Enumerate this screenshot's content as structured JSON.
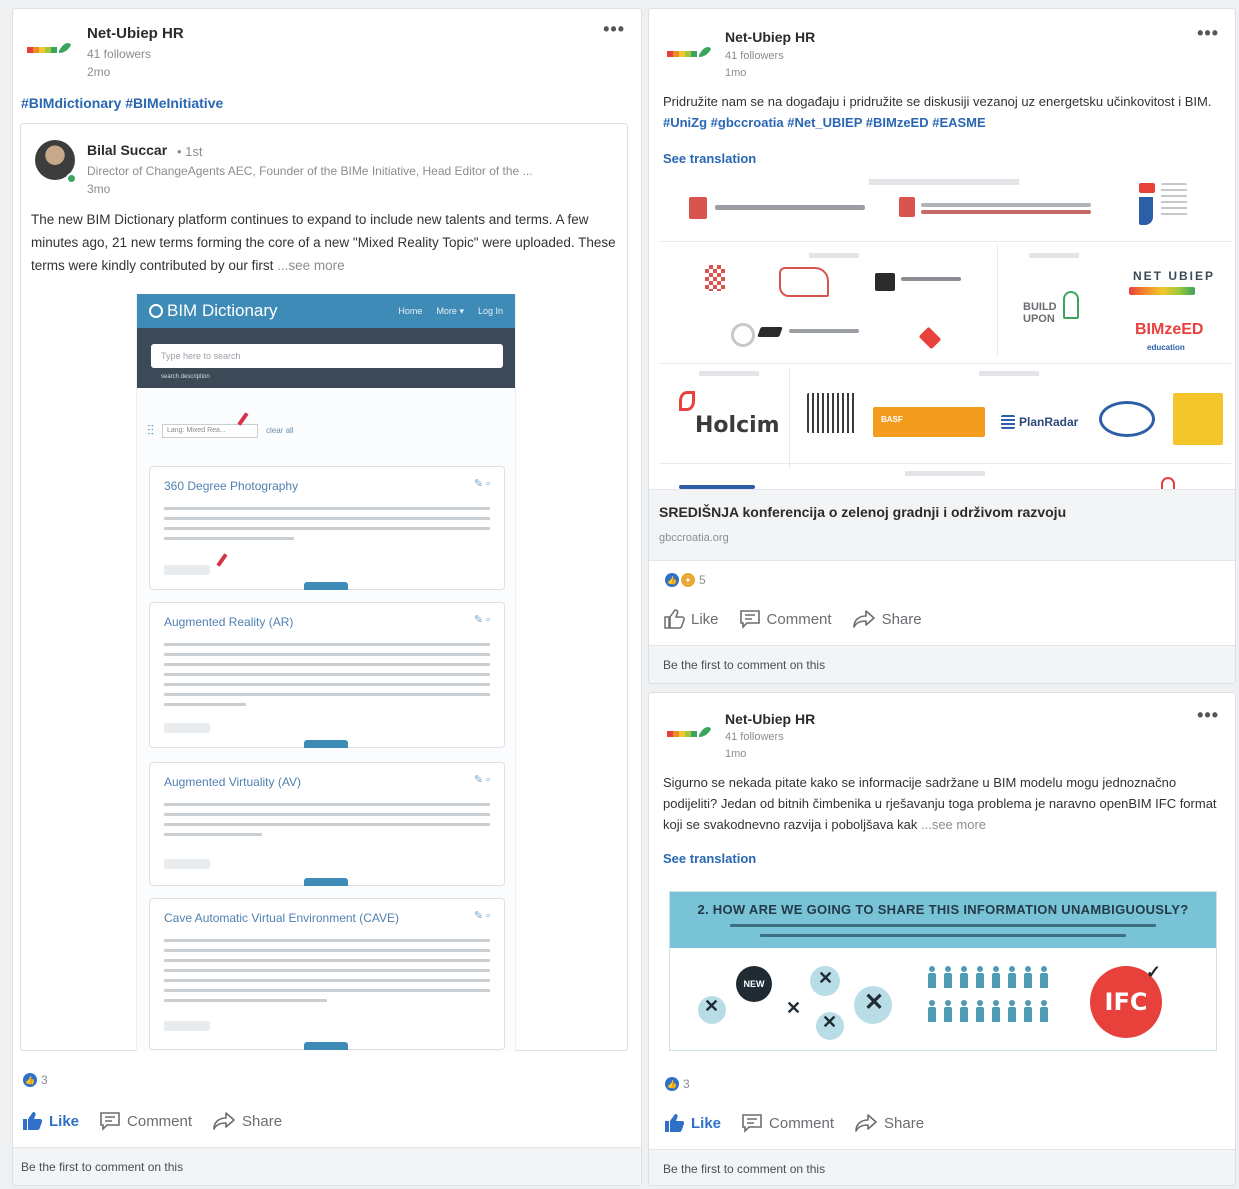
{
  "post_left": {
    "author": "Net-Ubiep HR",
    "followers": "41 followers",
    "time": "2mo",
    "hashtags": "#BIMdictionary #BIMeInitiative",
    "shared": {
      "author": "Bilal Succar",
      "degree": "• 1st",
      "headline": "Director of ChangeAgents AEC, Founder of the BIMe Initiative, Head Editor of the ...",
      "time": "3mo",
      "text": "The new BIM Dictionary platform continues to expand to include new talents and terms. A few minutes ago, 21 new terms forming the core of a new \"Mixed Reality Topic\" were uploaded. These terms were kindly contributed by our first",
      "see_more": "...see more",
      "screenshot": {
        "app_title": "BIM Dictionary",
        "nav": [
          "Home",
          "More ▾",
          "Log In"
        ],
        "search_placeholder": "Type here to search",
        "search_note": "search description",
        "filter_select": "Lang: Mixed Rea...",
        "filter_link": "clear all",
        "terms": [
          {
            "title": "360 Degree Photography"
          },
          {
            "title": "Augmented Reality (AR)"
          },
          {
            "title": "Augmented Virtuality (AV)"
          },
          {
            "title": "Cave Automatic Virtual Environment (CAVE)"
          }
        ]
      }
    },
    "reaction_count": "3",
    "actions": {
      "like": "Like",
      "comment": "Comment",
      "share": "Share"
    },
    "comment_prompt": "Be the first to comment on this"
  },
  "post_right_top": {
    "author": "Net-Ubiep HR",
    "followers": "41 followers",
    "time": "1mo",
    "text": "Pridružite nam se na događaju i pridružite se diskusiji vezanoj uz energetsku učinkovitost i BIM.",
    "hashtags": "#UniZg #gbccroatia #Net_UBIEP #BIMzeED #EASME",
    "see_translation": "See translation",
    "partners": {
      "holcim": "Holcim",
      "planradar": "PlanRadar",
      "build_upon": "BUILD UPON",
      "net_ubiep": "NET UBIEP",
      "bimzeed": "BIMzeED",
      "education": "education",
      "basf": "BASF"
    },
    "link_title": "SREDIŠNJA konferencija o zelenoj gradnji i održivom razvoju",
    "link_domain": "gbccroatia.org",
    "reaction_count": "5",
    "actions": {
      "like": "Like",
      "comment": "Comment",
      "share": "Share"
    },
    "comment_prompt": "Be the first to comment on this"
  },
  "post_right_bottom": {
    "author": "Net-Ubiep HR",
    "followers": "41 followers",
    "time": "1mo",
    "text": "Sigurno se nekada pitate kako se informacije sadržane u BIM modelu mogu jednoznačno podijeliti? Jedan od bitnih čimbenika u rješavanju toga problema je naravno openBIM IFC format koji se svakodnevno razvija i poboljšava kak",
    "see_more": "...see more",
    "see_translation": "See translation",
    "infographic": {
      "title": "2. HOW ARE WE GOING TO SHARE THIS INFORMATION UNAMBIGUOUSLY?",
      "new_label": "NEW",
      "ifc_label": "IFC"
    },
    "reaction_count": "3",
    "actions": {
      "like": "Like",
      "comment": "Comment",
      "share": "Share"
    },
    "comment_prompt": "Be the first to comment on this"
  },
  "colors": {
    "link": "#2a67b2",
    "like_blue": "#2f70c8",
    "muted": "#8a8d91"
  }
}
